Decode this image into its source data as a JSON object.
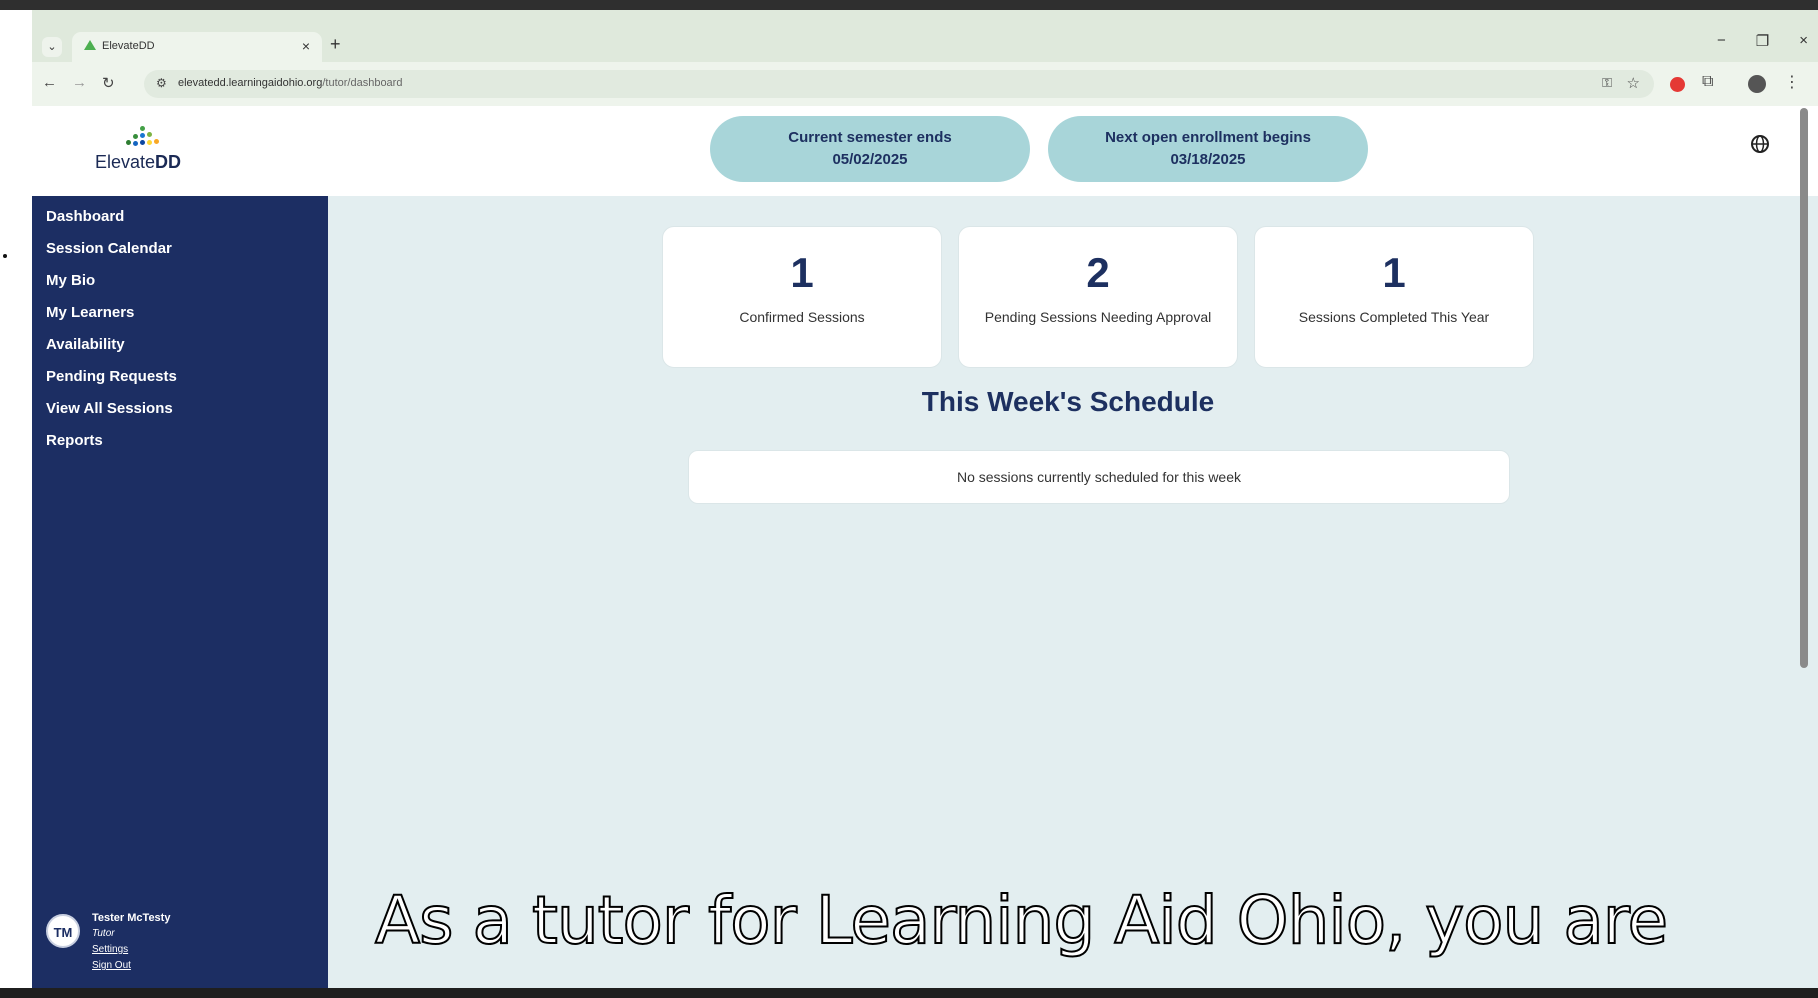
{
  "browser": {
    "tab_title": "ElevateDD",
    "tab_close": "×",
    "new_tab": "+",
    "url_host": "elevatedd.learningaidohio.org",
    "url_path": "/tutor/dashboard",
    "win_minimize": "−",
    "win_restore": "❐",
    "win_close": "×"
  },
  "header": {
    "logo_prefix": "Elevate",
    "logo_suffix": "DD",
    "semester_label": "Current semester ends",
    "semester_date": "05/02/2025",
    "enrollment_label": "Next open enrollment begins",
    "enrollment_date": "03/18/2025",
    "globe_icon": "globe-icon"
  },
  "sidebar": {
    "items": [
      {
        "label": "Dashboard"
      },
      {
        "label": "Session Calendar"
      },
      {
        "label": "My Bio"
      },
      {
        "label": "My Learners"
      },
      {
        "label": "Availability"
      },
      {
        "label": "Pending Requests"
      },
      {
        "label": "View All Sessions"
      },
      {
        "label": "Reports"
      }
    ],
    "user": {
      "initials": "TM",
      "name": "Tester McTesty",
      "role": "Tutor",
      "settings": "Settings",
      "signout": "Sign Out"
    }
  },
  "stats": [
    {
      "value": "1",
      "label": "Confirmed Sessions"
    },
    {
      "value": "2",
      "label": "Pending Sessions Needing Approval"
    },
    {
      "value": "1",
      "label": "Sessions Completed This Year"
    }
  ],
  "schedule": {
    "title": "This Week's Schedule",
    "empty_message": "No sessions currently scheduled for this week"
  },
  "caption": "As a tutor for Learning Aid Ohio, you are",
  "colors": {
    "sidebar": "#1c2e63",
    "pill": "#a8d5d9",
    "main_bg": "#e3eef0",
    "accent_text": "#1d3060"
  }
}
